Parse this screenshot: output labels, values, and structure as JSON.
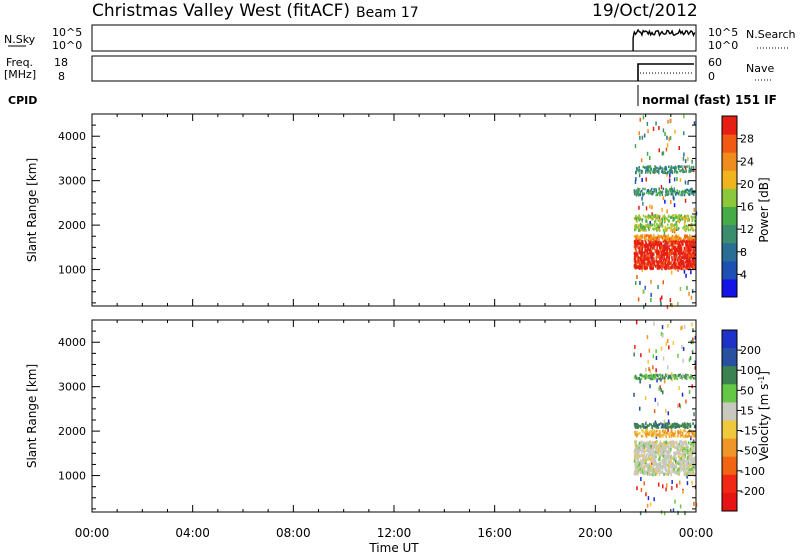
{
  "header": {
    "site": "Christmas Valley West (fitACF)",
    "beam": "Beam 17",
    "date": "19/Oct/2012"
  },
  "panels": {
    "nsky": {
      "label": "N.Sky",
      "tick_top": "10^5",
      "tick_bottom": "10^0",
      "right_label": "N.Search",
      "right_tick_top": "10^5",
      "right_tick_bottom": "10^0"
    },
    "freq": {
      "label_line1": "Freq.",
      "label_line2": "[MHz]",
      "tick_top": "18",
      "tick_bottom": "8",
      "right_label": "Nave",
      "right_tick_top": "60",
      "right_tick_bottom": "0"
    },
    "cpid": {
      "label": "CPID",
      "mode_text": "normal (fast) 151 IF"
    }
  },
  "colorbars": {
    "power": {
      "title": "Power [dB]",
      "colors": [
        "#1414e6",
        "#1e50b4",
        "#2a6e96",
        "#3c8c6e",
        "#46aa46",
        "#8cc83c",
        "#f0b41e",
        "#f08c1e",
        "#f05a14",
        "#e61e14"
      ],
      "ticks": [
        "4",
        "8",
        "12",
        "16",
        "20",
        "24",
        "28"
      ]
    },
    "velocity": {
      "title": "Velocity [m s^-1]",
      "colors": [
        "#1e32c8",
        "#2850a0",
        "#3c8250",
        "#64c846",
        "#c8c8be",
        "#f0c83c",
        "#f09628",
        "#f06414",
        "#f02814",
        "#e61414"
      ],
      "ticks": [
        "200",
        "100",
        "50",
        "15",
        "-15",
        "-50",
        "-100",
        "-200"
      ]
    }
  },
  "x_axis": {
    "label": "Time UT",
    "ticks": [
      "00:00",
      "04:00",
      "08:00",
      "12:00",
      "16:00",
      "20:00",
      "00:00"
    ]
  },
  "chart_data": [
    {
      "type": "heatmap",
      "name": "power",
      "ylabel": "Slant Range [km]",
      "yticks": [
        1000,
        2000,
        3000,
        4000
      ],
      "ylim": [
        180,
        4500
      ],
      "xlim": [
        0,
        24
      ],
      "data_window_hours": [
        21.5,
        24
      ],
      "bands": [
        {
          "range": [
            1050,
            1700
          ],
          "value_db": 28
        },
        {
          "range": [
            1700,
            1800
          ],
          "value_db": 22
        },
        {
          "range": [
            1900,
            2050
          ],
          "value_db": 16
        },
        {
          "range": [
            2100,
            2250
          ],
          "value_db": 14
        },
        {
          "range": [
            2700,
            2850
          ],
          "value_db": 8
        },
        {
          "range": [
            3200,
            3350
          ],
          "value_db": 10
        }
      ]
    },
    {
      "type": "heatmap",
      "name": "velocity",
      "ylabel": "Slant Range [km]",
      "yticks": [
        1000,
        2000,
        3000,
        4000
      ],
      "ylim": [
        180,
        4500
      ],
      "xlim": [
        0,
        24
      ],
      "data_window_hours": [
        21.5,
        24
      ],
      "bands": [
        {
          "range": [
            1050,
            1800
          ],
          "value_ms": 0
        },
        {
          "range": [
            1900,
            2050
          ],
          "value_ms": -50
        },
        {
          "range": [
            2100,
            2200
          ],
          "value_ms": 60
        },
        {
          "range": [
            3200,
            3300
          ],
          "value_ms": 30
        }
      ]
    }
  ]
}
